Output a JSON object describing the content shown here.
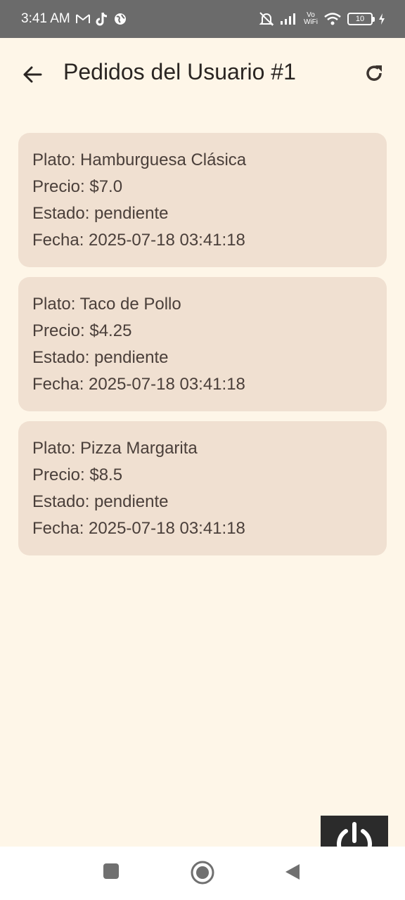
{
  "status_bar": {
    "time": "3:41 AM",
    "left_icons": [
      "gmail-icon",
      "tiktok-icon",
      "globe-icon"
    ],
    "vo_label_top": "Vo",
    "vo_label_bottom": "WiFi",
    "battery_level": "10",
    "right_icons": [
      "mute-bell-icon",
      "signal-icon",
      "vowifi-icon",
      "wifi-icon",
      "battery-icon",
      "charging-icon"
    ]
  },
  "app_bar": {
    "title": "Pedidos del Usuario #1",
    "back_icon": "arrow-back-icon",
    "refresh_icon": "refresh-icon"
  },
  "orders": [
    {
      "plato": "Plato: Hamburguesa Clásica",
      "precio": "Precio: $7.0",
      "estado": "Estado: pendiente",
      "fecha": "Fecha: 2025-07-18 03:41:18"
    },
    {
      "plato": "Plato: Taco de Pollo",
      "precio": "Precio: $4.25",
      "estado": "Estado: pendiente",
      "fecha": "Fecha: 2025-07-18 03:41:18"
    },
    {
      "plato": "Plato: Pizza Margarita",
      "precio": "Precio: $8.5",
      "estado": "Estado: pendiente",
      "fecha": "Fecha: 2025-07-18 03:41:18"
    }
  ],
  "colors": {
    "background": "#fef6e8",
    "card": "#f0e0d1",
    "status_bar": "#6b6b6b",
    "text": "#4a3f3a"
  },
  "nav_bar": {
    "icons": [
      "recent-apps-icon",
      "home-icon",
      "nav-back-icon"
    ]
  },
  "overlay": {
    "icon": "power-icon"
  }
}
